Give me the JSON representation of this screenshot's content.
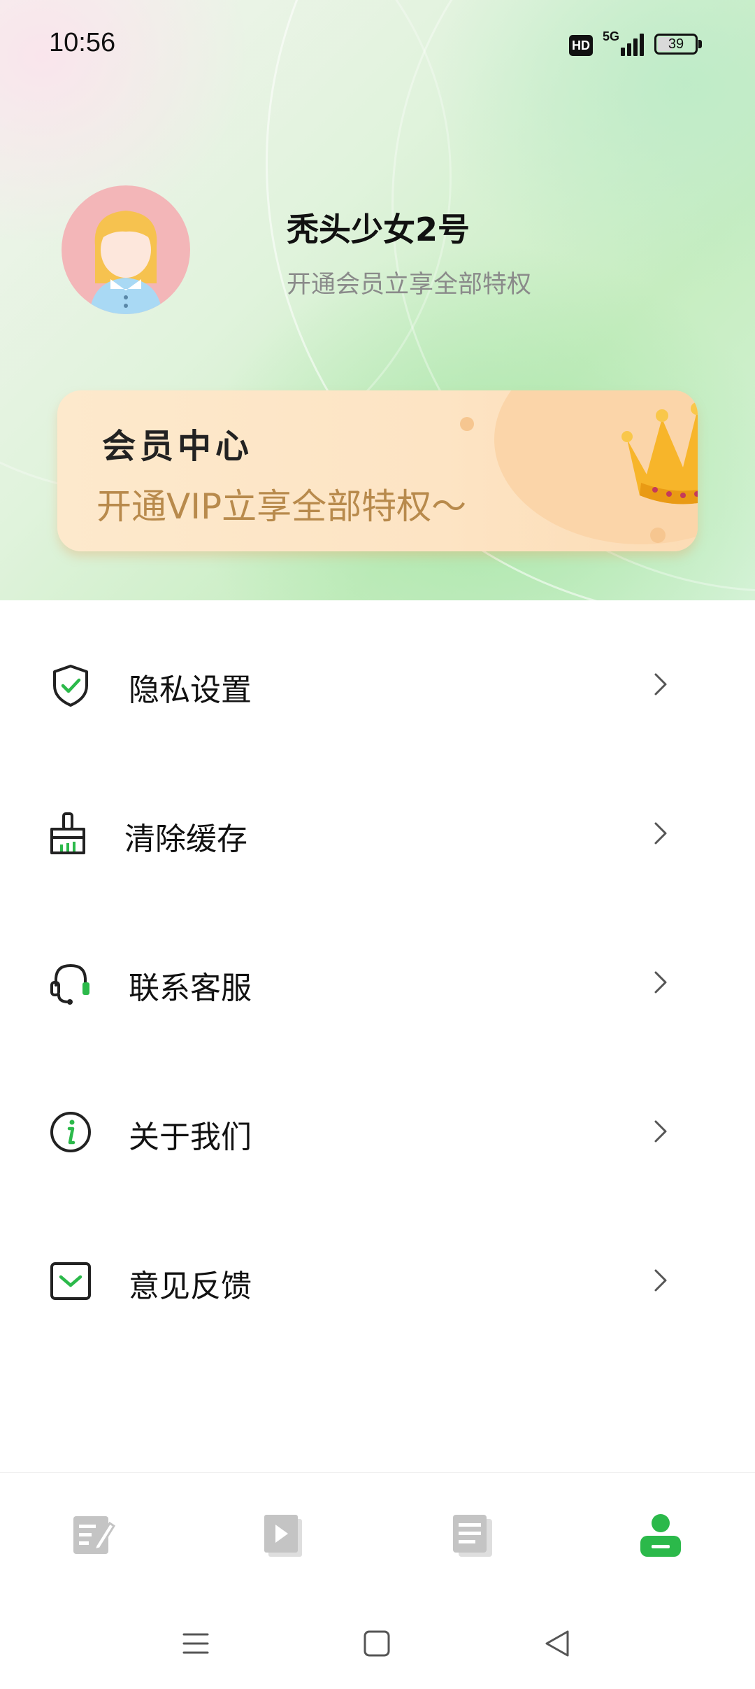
{
  "status_bar": {
    "time": "10:56",
    "hd": "HD",
    "network": "5G",
    "battery": "39",
    "battery_level": 0.39
  },
  "profile": {
    "name": "秃头少女2号",
    "subtitle": "开通会员立享全部特权"
  },
  "vip_card": {
    "title": "会员中心",
    "subtitle": "开通VIP立享全部特权～"
  },
  "menu": [
    {
      "label": "隐私设置",
      "icon": "shield-check-icon"
    },
    {
      "label": "清除缓存",
      "icon": "broom-icon"
    },
    {
      "label": "联系客服",
      "icon": "headset-icon"
    },
    {
      "label": "关于我们",
      "icon": "info-icon"
    },
    {
      "label": "意见反馈",
      "icon": "feedback-mail-icon"
    }
  ],
  "tabbar": {
    "tabs": [
      {
        "icon": "edit-note-icon",
        "active": false
      },
      {
        "icon": "video-play-icon",
        "active": false
      },
      {
        "icon": "document-icon",
        "active": false
      },
      {
        "icon": "profile-user-icon",
        "active": true
      }
    ],
    "active_color": "#2bb94a",
    "inactive_color": "#c4c4c4"
  },
  "colors": {
    "accent_green": "#2bb94a",
    "vip_gold": "#b88a4c"
  }
}
